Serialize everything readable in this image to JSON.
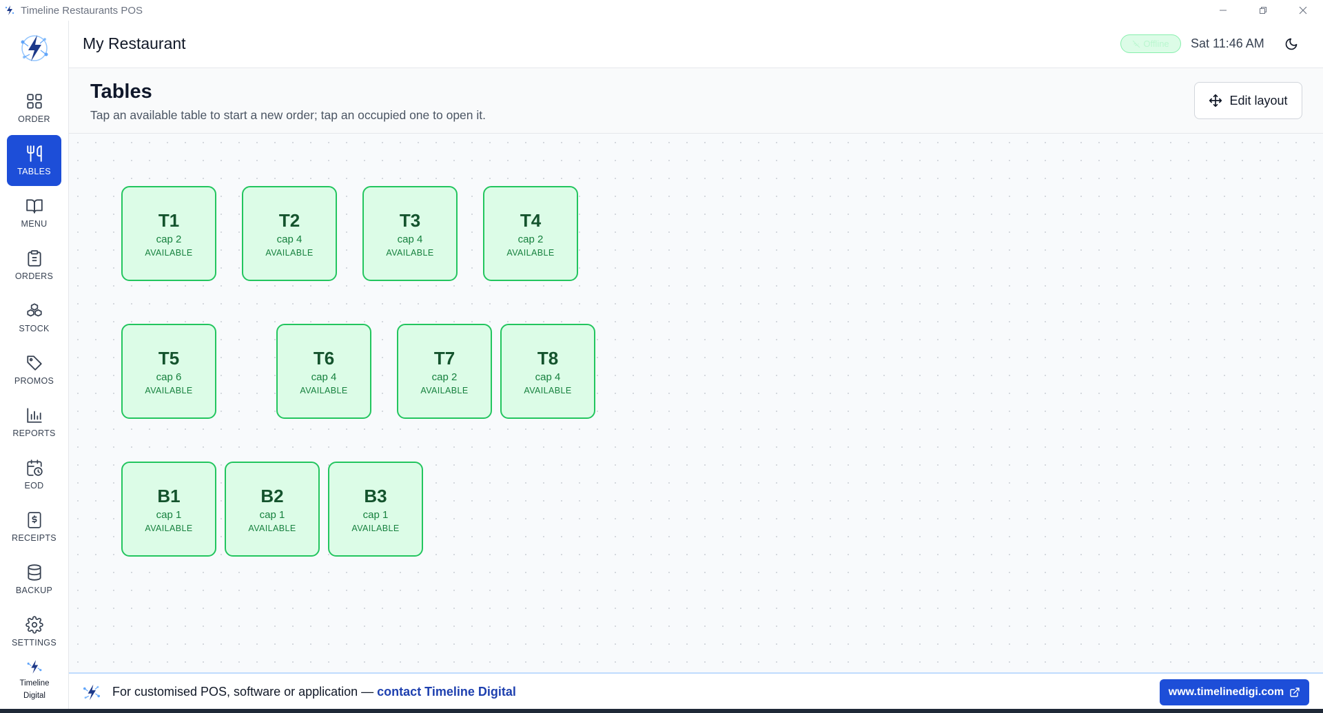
{
  "window": {
    "title": "Timeline Restaurants POS"
  },
  "sidebar": {
    "items": [
      {
        "label": "ORDER",
        "icon": "grid-icon"
      },
      {
        "label": "TABLES",
        "icon": "utensils-icon",
        "active": true
      },
      {
        "label": "MENU",
        "icon": "book-icon"
      },
      {
        "label": "ORDERS",
        "icon": "clipboard-icon"
      },
      {
        "label": "STOCK",
        "icon": "boxes-icon"
      },
      {
        "label": "PROMOS",
        "icon": "tag-icon"
      },
      {
        "label": "REPORTS",
        "icon": "bar-chart-icon"
      },
      {
        "label": "EOD",
        "icon": "calendar-clock-icon"
      },
      {
        "label": "RECEIPTS",
        "icon": "receipt-icon"
      },
      {
        "label": "BACKUP",
        "icon": "database-icon"
      },
      {
        "label": "SETTINGS",
        "icon": "gear-icon"
      }
    ],
    "brand": {
      "line1": "Timeline",
      "line2": "Digital"
    }
  },
  "header": {
    "restaurant_name": "My Restaurant",
    "status": "Offline",
    "datetime": "Sat 11:46 AM"
  },
  "page": {
    "title": "Tables",
    "subtitle": "Tap an available table to start a new order; tap an occupied one to open it.",
    "edit_layout_label": "Edit layout"
  },
  "tables": [
    {
      "name": "T1",
      "cap": "cap 2",
      "status": "AVAILABLE"
    },
    {
      "name": "T2",
      "cap": "cap 4",
      "status": "AVAILABLE"
    },
    {
      "name": "T3",
      "cap": "cap 4",
      "status": "AVAILABLE"
    },
    {
      "name": "T4",
      "cap": "cap 2",
      "status": "AVAILABLE"
    },
    {
      "name": "T5",
      "cap": "cap 6",
      "status": "AVAILABLE"
    },
    {
      "name": "T6",
      "cap": "cap 4",
      "status": "AVAILABLE"
    },
    {
      "name": "T7",
      "cap": "cap 2",
      "status": "AVAILABLE"
    },
    {
      "name": "T8",
      "cap": "cap 4",
      "status": "AVAILABLE"
    },
    {
      "name": "B1",
      "cap": "cap 1",
      "status": "AVAILABLE"
    },
    {
      "name": "B2",
      "cap": "cap 1",
      "status": "AVAILABLE"
    },
    {
      "name": "B3",
      "cap": "cap 1",
      "status": "AVAILABLE"
    }
  ],
  "footer": {
    "text": "For customised POS, software or application —",
    "link_text": "contact Timeline Digital",
    "site_button": "www.timelinedigi.com"
  },
  "colors": {
    "accent": "#1d4ed8",
    "table_available_bg": "#dcfce7",
    "table_available_border": "#22c55e"
  }
}
